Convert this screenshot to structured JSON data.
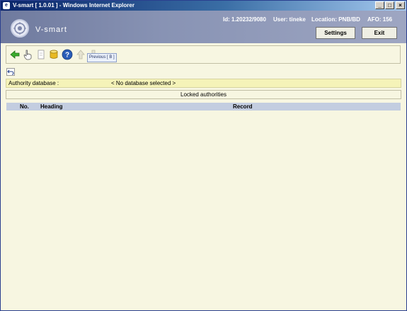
{
  "window": {
    "title": "V-smart [ 1.0.01 ] - Windows Internet Explorer",
    "minimize": "_",
    "maximize": "□",
    "close": "×"
  },
  "header": {
    "logo_text": "V-smart",
    "status": {
      "id": "Id: 1.20232/9080",
      "user": "User: tineke",
      "location": "Location: PNB/BD",
      "afo": "AFO: 156"
    },
    "settings_label": "Settings",
    "exit_label": "Exit"
  },
  "toolbar": {
    "icons": [
      "back-arrow-icon",
      "hand-pointer-icon",
      "document-icon",
      "database-icon",
      "help-icon",
      "up-arrow-icon",
      "previous-icon"
    ],
    "tooltip": "Previous [ B ]"
  },
  "database": {
    "label": "Authority database :",
    "value": "< No database selected >"
  },
  "section_title": "Locked authorities",
  "table": {
    "columns": [
      "No.",
      "Heading",
      "Record"
    ],
    "rows": []
  },
  "colors": {
    "titlebar": "#0a246a",
    "header": "#8893b4",
    "background": "#f7f6e1",
    "db_row": "#f5f3b8",
    "table_header": "#c3cde0"
  }
}
